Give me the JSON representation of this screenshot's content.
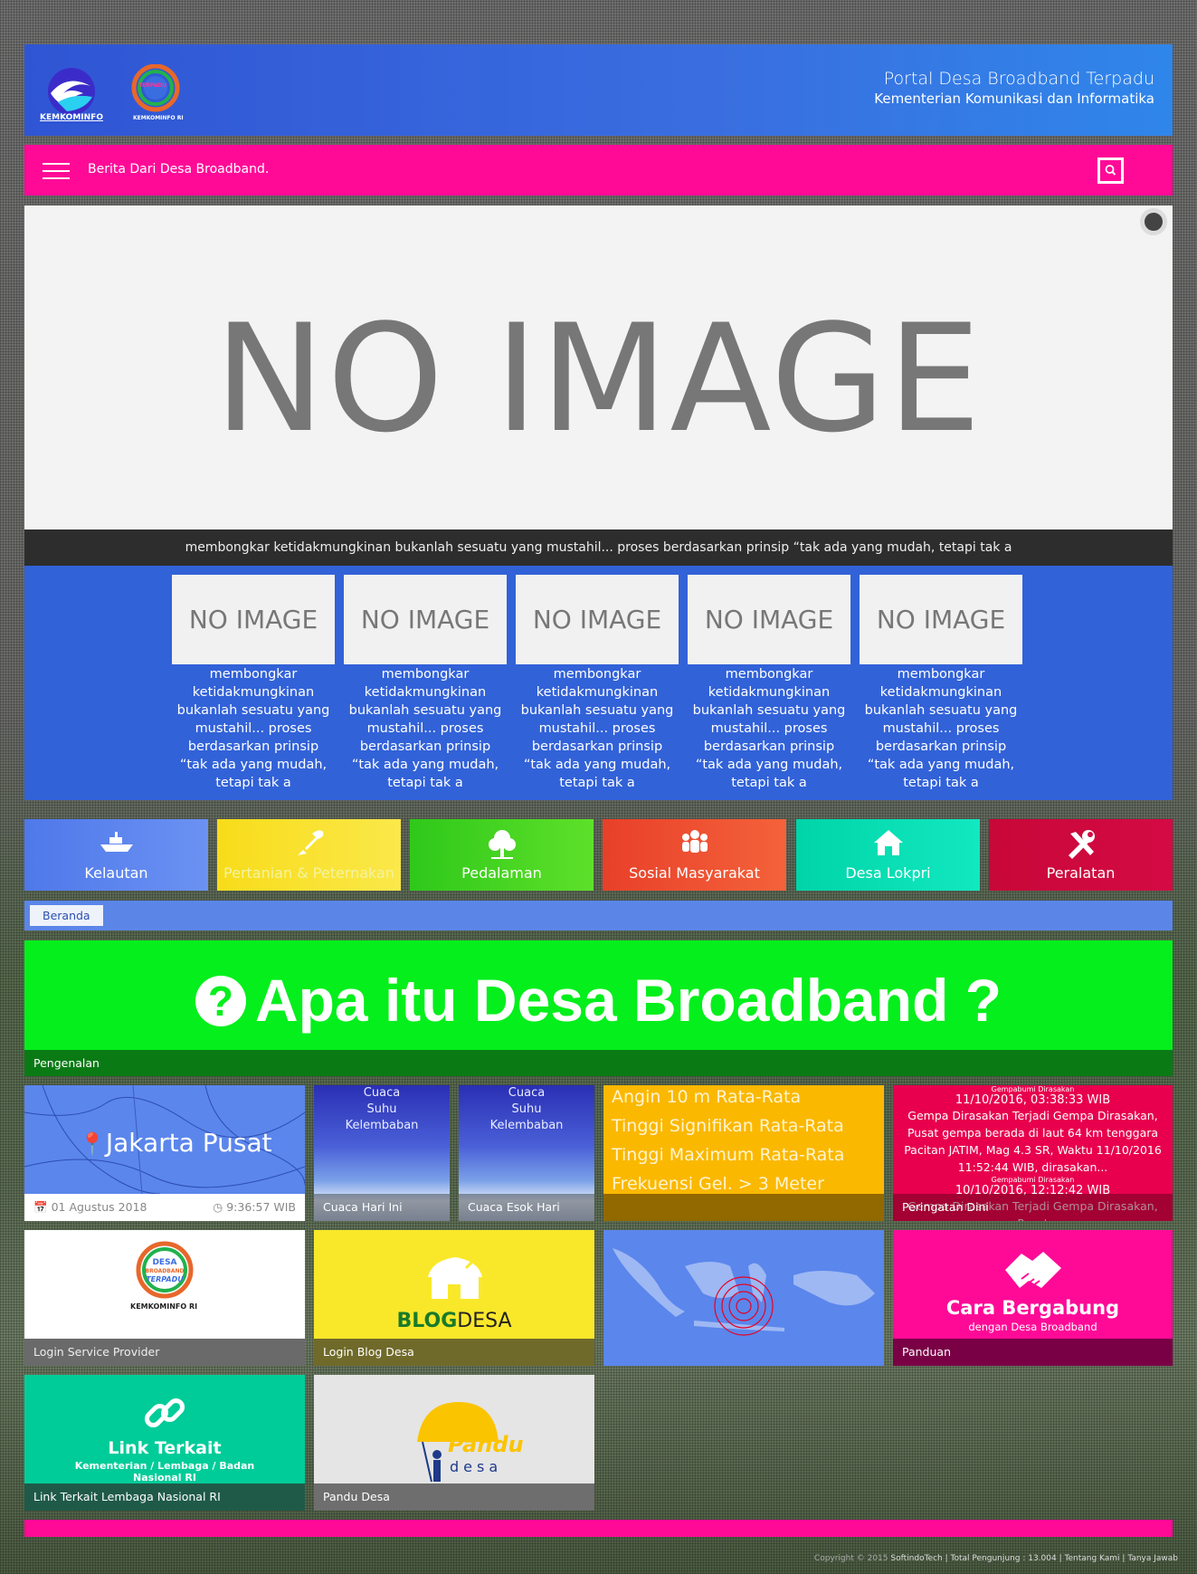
{
  "header": {
    "kominfo_label": "KEMKOMINFO",
    "terpadu_label": "TERPADU",
    "terpadu_sub": "KEMKOMINFO RI",
    "title": "Portal Desa Broadband Terpadu",
    "subtitle": "Kementerian Komunikasi dan Informatika"
  },
  "nav": {
    "news_text": "Berita Dari Desa Broadband."
  },
  "hero": {
    "placeholder": "NO IMAGE",
    "caption": "membongkar ketidakmungkinan bukanlah sesuatu yang mustahil... proses berdasarkan prinsip “tak ada yang mudah, tetapi tak a"
  },
  "thumbs": [
    {
      "placeholder": "NO IMAGE",
      "text": "membongkar ketidakmungkinan bukanlah sesuatu yang mustahil... proses berdasarkan prinsip “tak ada yang mudah, tetapi tak a"
    },
    {
      "placeholder": "NO IMAGE",
      "text": "membongkar ketidakmungkinan bukanlah sesuatu yang mustahil... proses berdasarkan prinsip “tak ada yang mudah, tetapi tak a"
    },
    {
      "placeholder": "NO IMAGE",
      "text": "membongkar ketidakmungkinan bukanlah sesuatu yang mustahil... proses berdasarkan prinsip “tak ada yang mudah, tetapi tak a"
    },
    {
      "placeholder": "NO IMAGE",
      "text": "membongkar ketidakmungkinan bukanlah sesuatu yang mustahil... proses berdasarkan prinsip “tak ada yang mudah, tetapi tak a"
    },
    {
      "placeholder": "NO IMAGE",
      "text": "membongkar ketidakmungkinan bukanlah sesuatu yang mustahil... proses berdasarkan prinsip “tak ada yang mudah, tetapi tak a"
    }
  ],
  "categories": [
    {
      "label": "Kelautan",
      "icon": "ship-icon",
      "color": "#5b82ee"
    },
    {
      "label": "Pertanian & Peternakan",
      "icon": "shovel-icon",
      "color": "#f7e02a"
    },
    {
      "label": "Pedalaman",
      "icon": "tree-icon",
      "color": "#3fd21c"
    },
    {
      "label": "Sosial Masyarakat",
      "icon": "people-icon",
      "color": "#ee4a2a"
    },
    {
      "label": "Desa Lokpri",
      "icon": "home-icon",
      "color": "#05dcb2"
    },
    {
      "label": "Peralatan",
      "icon": "tools-icon",
      "color": "#d0083c"
    }
  ],
  "breadcrumb": {
    "home": "Beranda"
  },
  "intro": {
    "title": "Apa itu Desa Broadband ?",
    "icon": "question-circle-icon",
    "label": "Pengenalan"
  },
  "tiles": {
    "location": {
      "city": "Jakarta Pusat",
      "date": "01 Agustus 2018",
      "time": "9:36:57 WIB"
    },
    "weather_today": {
      "lines": [
        "Cuaca",
        "Suhu",
        "Kelembaban"
      ],
      "label": "Cuaca Hari Ini"
    },
    "weather_tomorrow": {
      "lines": [
        "Cuaca",
        "Suhu",
        "Kelembaban"
      ],
      "label": "Cuaca Esok Hari"
    },
    "waves": [
      "Angin 10 m Rata-Rata",
      "Tinggi Signifikan Rata-Rata",
      "Tinggi Maximum Rata-Rata",
      "Frekuensi Gel. > 3 Meter"
    ],
    "quake": {
      "source": "Gempabumi Dirasakan",
      "datetime": "11/10/2016, 03:38:33 WIB",
      "body": "Gempa Dirasakan Terjadi Gempa Dirasakan, Pusat gempa berada di laut 64 km tenggara Pacitan JATIM, Mag 4.3 SR, Waktu 11/10/2016 11:52:44 WIB, dirasakan...",
      "source2": "Gempabumi Dirasakan",
      "datetime2": "10/10/2016, 12:12:42 WIB",
      "body2": "Gempa Dirasakan Terjadi Gempa Dirasakan, Pusat",
      "label": "Peringatan Dini"
    },
    "service_provider": {
      "logo_line1": "DESA",
      "logo_line2": "BROADBAND",
      "logo_line3": "TERPADU",
      "logo_sub": "KEMKOMINFO RI",
      "label": "Login Service Provider"
    },
    "blog": {
      "logo_bold": "BLOG",
      "logo_rest": "DESA",
      "label": "Login Blog Desa"
    },
    "join": {
      "title": "Cara Bergabung",
      "subtitle": "dengan Desa Broadband",
      "label": "Panduan"
    },
    "links": {
      "title": "Link Terkait",
      "subtitle": "Kementerian / Lembaga / Badan Nasional RI",
      "label": "Link Terkait Lembaga Nasional RI"
    },
    "pandu": {
      "logo1": "Pandu",
      "logo2": "desa",
      "label": "Pandu Desa"
    }
  },
  "footer": {
    "copyright": "Copyright © 2015",
    "brand": "SoftindoTech",
    "visitors": "Total Pengunjung : 13.004",
    "about": "Tentang Kami",
    "faq": "Tanya Jawab"
  },
  "colors": {
    "blue": "#3262d8",
    "pink": "#ff0a97",
    "green": "#04ef1c"
  }
}
